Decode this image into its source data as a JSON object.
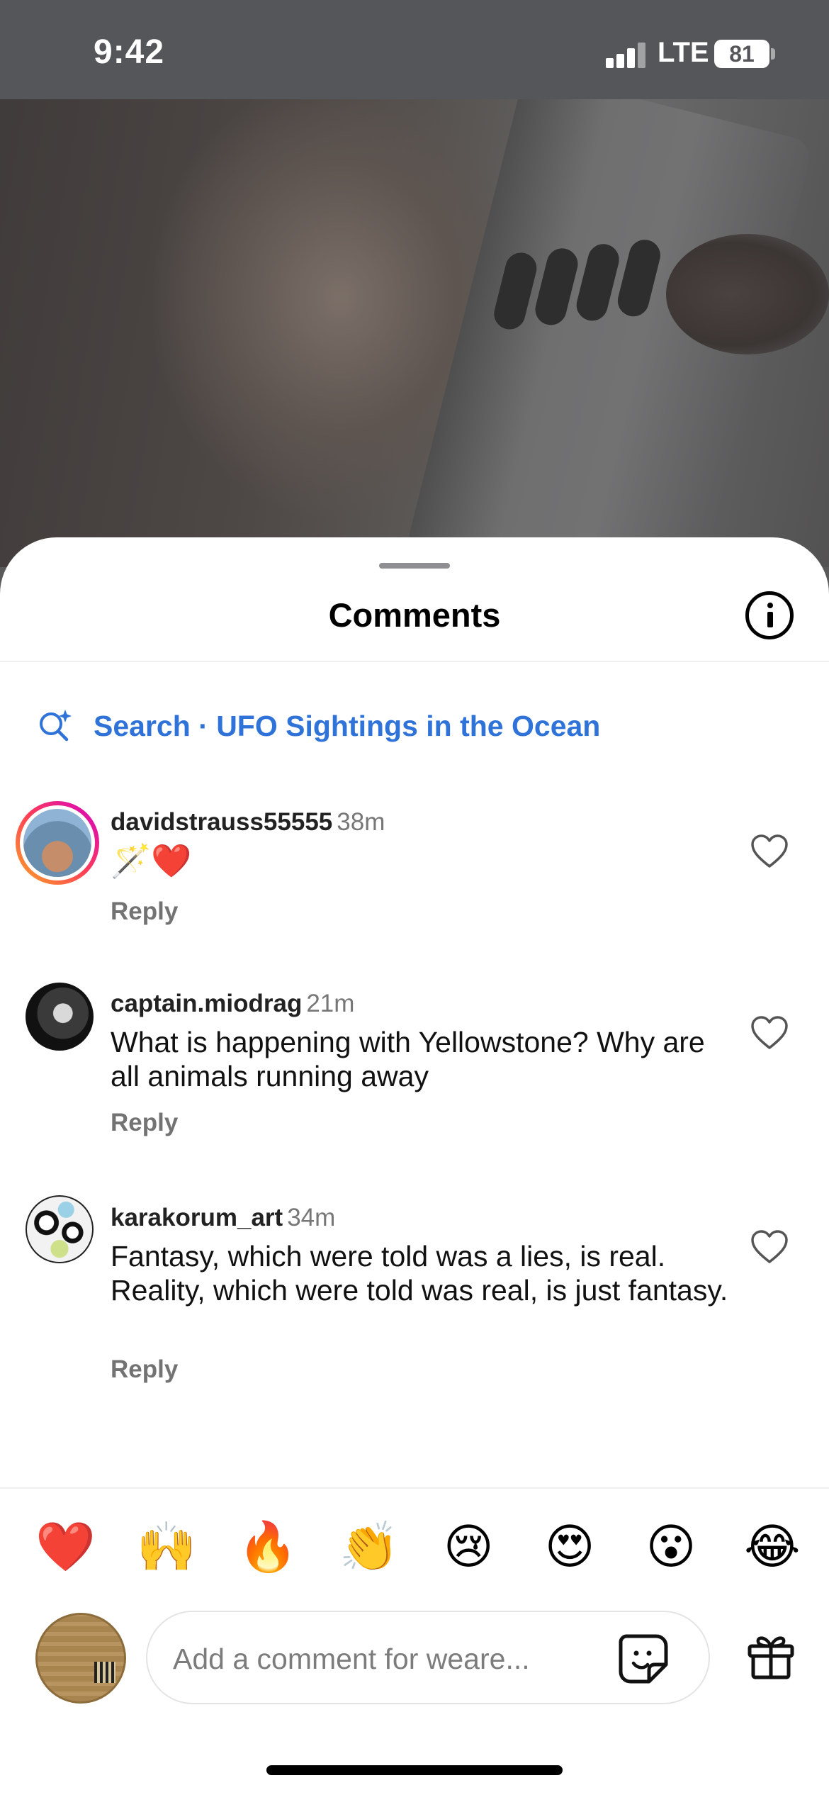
{
  "status_bar": {
    "time": "9:42",
    "network": "LTE",
    "battery": "81"
  },
  "sheet": {
    "title": "Comments"
  },
  "search": {
    "label": "Search · UFO Sightings in the Ocean"
  },
  "comments": [
    {
      "username": "davidstrauss55555",
      "time": "38m",
      "text": "🪄❤️",
      "reply_label": "Reply"
    },
    {
      "username": "captain.miodrag",
      "time": "21m",
      "text": "What is happening with Yellowstone? Why are all animals running away",
      "reply_label": "Reply"
    },
    {
      "username": "karakorum_art",
      "time": "34m",
      "text": "Fantasy, which were told was a lies, is real. Reality, which were told was real, is just fantasy.",
      "reply_label": "Reply"
    }
  ],
  "reactions": [
    "❤️",
    "🙌",
    "🔥",
    "👏",
    "😢",
    "😍",
    "😮",
    "😂"
  ],
  "composer": {
    "placeholder": "Add a comment for weare..."
  },
  "icons": [
    "info-icon",
    "search-ai-icon",
    "heart-outline-icon",
    "sticker-icon",
    "gift-icon"
  ],
  "colors": {
    "link": "#2f73d9",
    "story_ring_start": "#f9a825",
    "story_ring_end": "#d300c5"
  }
}
